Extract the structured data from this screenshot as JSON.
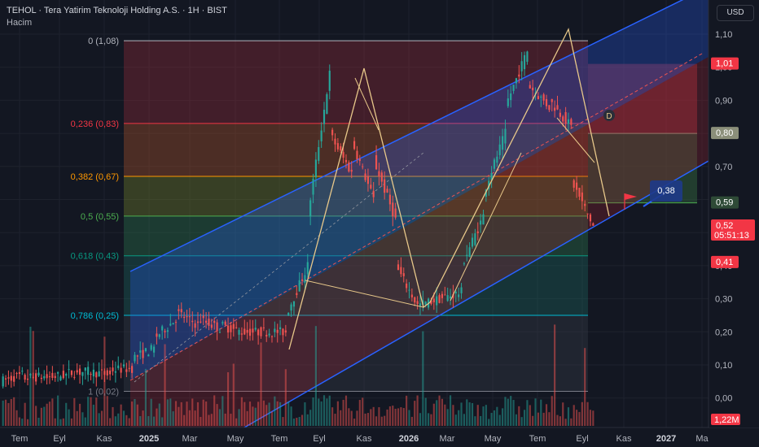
{
  "header": {
    "title": "TEHOL · Tera Yatirim Teknoloji Holding A.S. · 1H · BIST",
    "volume_label": "Hacim",
    "currency": "USD"
  },
  "colors": {
    "up": "#26a69a",
    "down": "#ef5350",
    "channel": "#2962ff",
    "pattern": "#e8c88a"
  },
  "chart_data": {
    "type": "candlestick",
    "symbol": "TEHOL",
    "interval": "1H",
    "exchange": "BIST",
    "currency": "USD",
    "ylim": [
      -0.05,
      1.2
    ],
    "y_ticks": [
      "1,10",
      "1,00",
      "0,90",
      "0,80",
      "0,70",
      "0,60",
      "0,50",
      "0,40",
      "0,30",
      "0,20",
      "0,10",
      "0,00"
    ],
    "x_ticks": [
      {
        "label": "Tem",
        "bold": false
      },
      {
        "label": "Eyl",
        "bold": false
      },
      {
        "label": "Kas",
        "bold": false
      },
      {
        "label": "2025",
        "bold": true
      },
      {
        "label": "Mar",
        "bold": false
      },
      {
        "label": "May",
        "bold": false
      },
      {
        "label": "Tem",
        "bold": false
      },
      {
        "label": "Eyl",
        "bold": false
      },
      {
        "label": "Kas",
        "bold": false
      },
      {
        "label": "2026",
        "bold": true
      },
      {
        "label": "Mar",
        "bold": false
      },
      {
        "label": "May",
        "bold": false
      },
      {
        "label": "Tem",
        "bold": false
      },
      {
        "label": "Eyl",
        "bold": false
      },
      {
        "label": "Kas",
        "bold": false
      },
      {
        "label": "2027",
        "bold": true
      },
      {
        "label": "Ma",
        "bold": false
      }
    ],
    "price_path": [
      [
        0.05,
        0.07
      ],
      [
        0.06,
        0.065
      ],
      [
        0.06,
        0.07
      ],
      [
        0.075,
        0.08
      ],
      [
        0.08,
        0.07
      ],
      [
        0.085,
        0.09
      ],
      [
        0.12,
        0.15
      ],
      [
        0.18,
        0.24
      ],
      [
        0.26,
        0.22
      ],
      [
        0.24,
        0.21
      ],
      [
        0.22,
        0.2
      ],
      [
        0.2,
        0.2
      ],
      [
        0.2,
        0.2
      ],
      [
        0.25,
        0.4
      ],
      [
        0.55,
        0.98
      ],
      [
        0.8,
        0.68
      ],
      [
        0.78,
        0.6
      ],
      [
        0.72,
        0.54
      ],
      [
        0.4,
        0.28
      ],
      [
        0.28,
        0.3
      ],
      [
        0.3,
        0.32
      ],
      [
        0.4,
        0.55
      ],
      [
        0.62,
        0.8
      ],
      [
        0.88,
        1.05
      ],
      [
        0.95,
        0.88
      ],
      [
        0.9,
        0.82
      ],
      [
        0.66,
        0.52
      ]
    ],
    "fibonacci": [
      {
        "ratio": "0 (1,08)",
        "value": 1.08,
        "color": "#b2b5be"
      },
      {
        "ratio": "0,236 (0,83)",
        "value": 0.83,
        "color": "#f23645"
      },
      {
        "ratio": "0,382 (0,67)",
        "value": 0.67,
        "color": "#ff9800"
      },
      {
        "ratio": "0,5 (0,55)",
        "value": 0.55,
        "color": "#4caf50"
      },
      {
        "ratio": "0,618 (0,43)",
        "value": 0.43,
        "color": "#089981"
      },
      {
        "ratio": "0,786 (0,25)",
        "value": 0.25,
        "color": "#00bcd4"
      },
      {
        "ratio": "1 (0,02)",
        "value": 0.02,
        "color": "#787b86"
      }
    ],
    "price_tags": [
      {
        "text": "1,01",
        "value": 1.01,
        "color": "#f23645"
      },
      {
        "text": "0,80",
        "value": 0.8,
        "color": "#8b8f7a"
      },
      {
        "text": "0,59",
        "value": 0.59,
        "color": "#2e4a36"
      },
      {
        "text": "0,52",
        "value": 0.52,
        "color": "#f23645",
        "extra": "05:51:13"
      },
      {
        "text": "0,41",
        "value": 0.41,
        "color": "#f23645"
      }
    ],
    "volume_tag": "1,22M",
    "pattern_marker": "D",
    "target_label": "0,38"
  }
}
